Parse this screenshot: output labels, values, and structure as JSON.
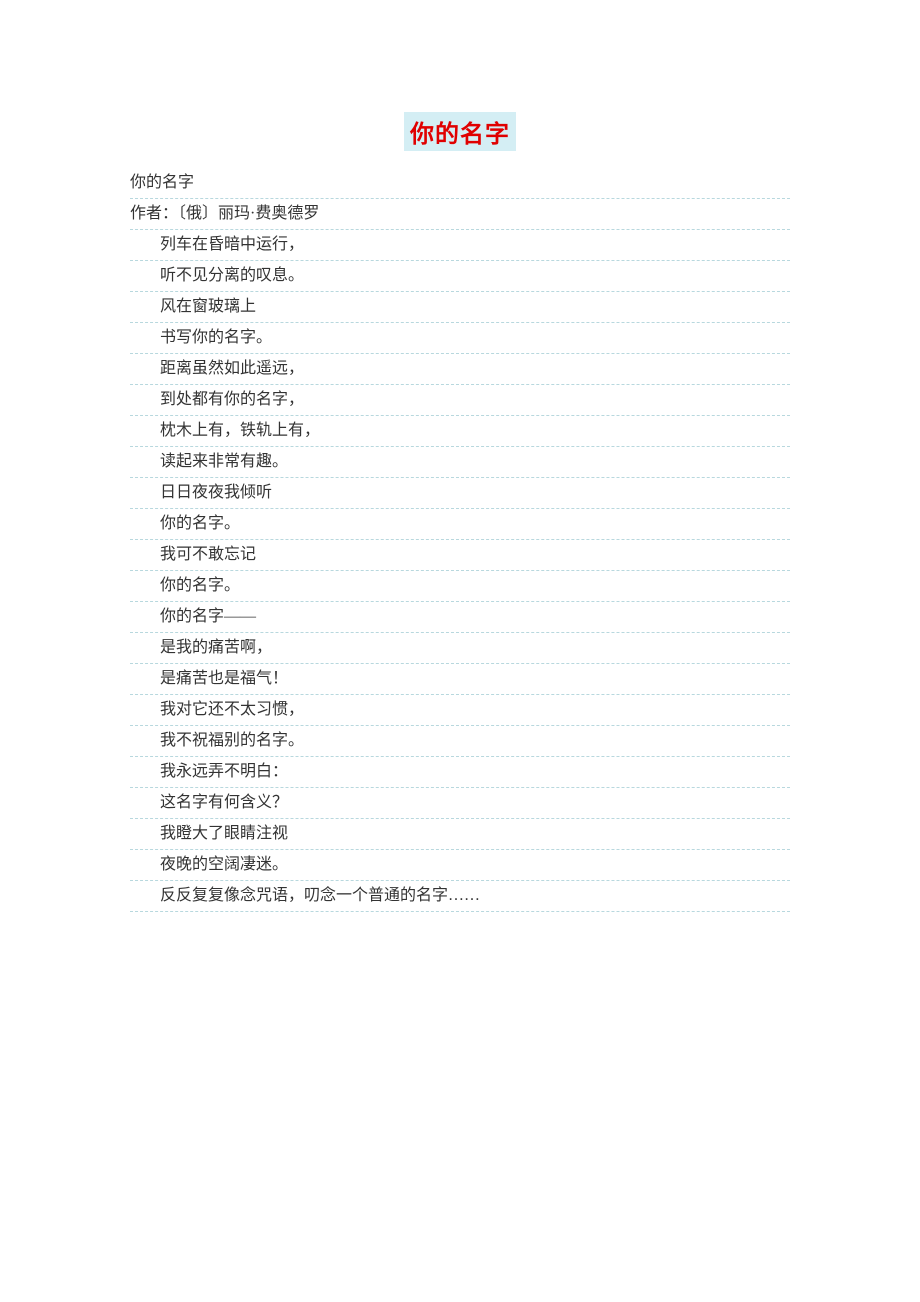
{
  "title": "你的名字",
  "header": {
    "subtitle": "你的名字",
    "author": "作者：〔俄〕丽玛·费奥德罗"
  },
  "lines": [
    "列车在昏暗中运行，",
    "听不见分离的叹息。",
    "风在窗玻璃上",
    "书写你的名字。",
    "距离虽然如此遥远，",
    "到处都有你的名字，",
    "枕木上有，铁轨上有，",
    "读起来非常有趣。",
    "日日夜夜我倾听",
    "你的名字。",
    "我可不敢忘记",
    "你的名字。",
    "你的名字——",
    "是我的痛苦啊，",
    "是痛苦也是福气！",
    "我对它还不太习惯，",
    "我不祝福别的名字。",
    "我永远弄不明白：",
    "这名字有何含义？",
    "我瞪大了眼睛注视",
    "夜晚的空阔凄迷。",
    "反反复复像念咒语，叨念一个普通的名字……"
  ]
}
